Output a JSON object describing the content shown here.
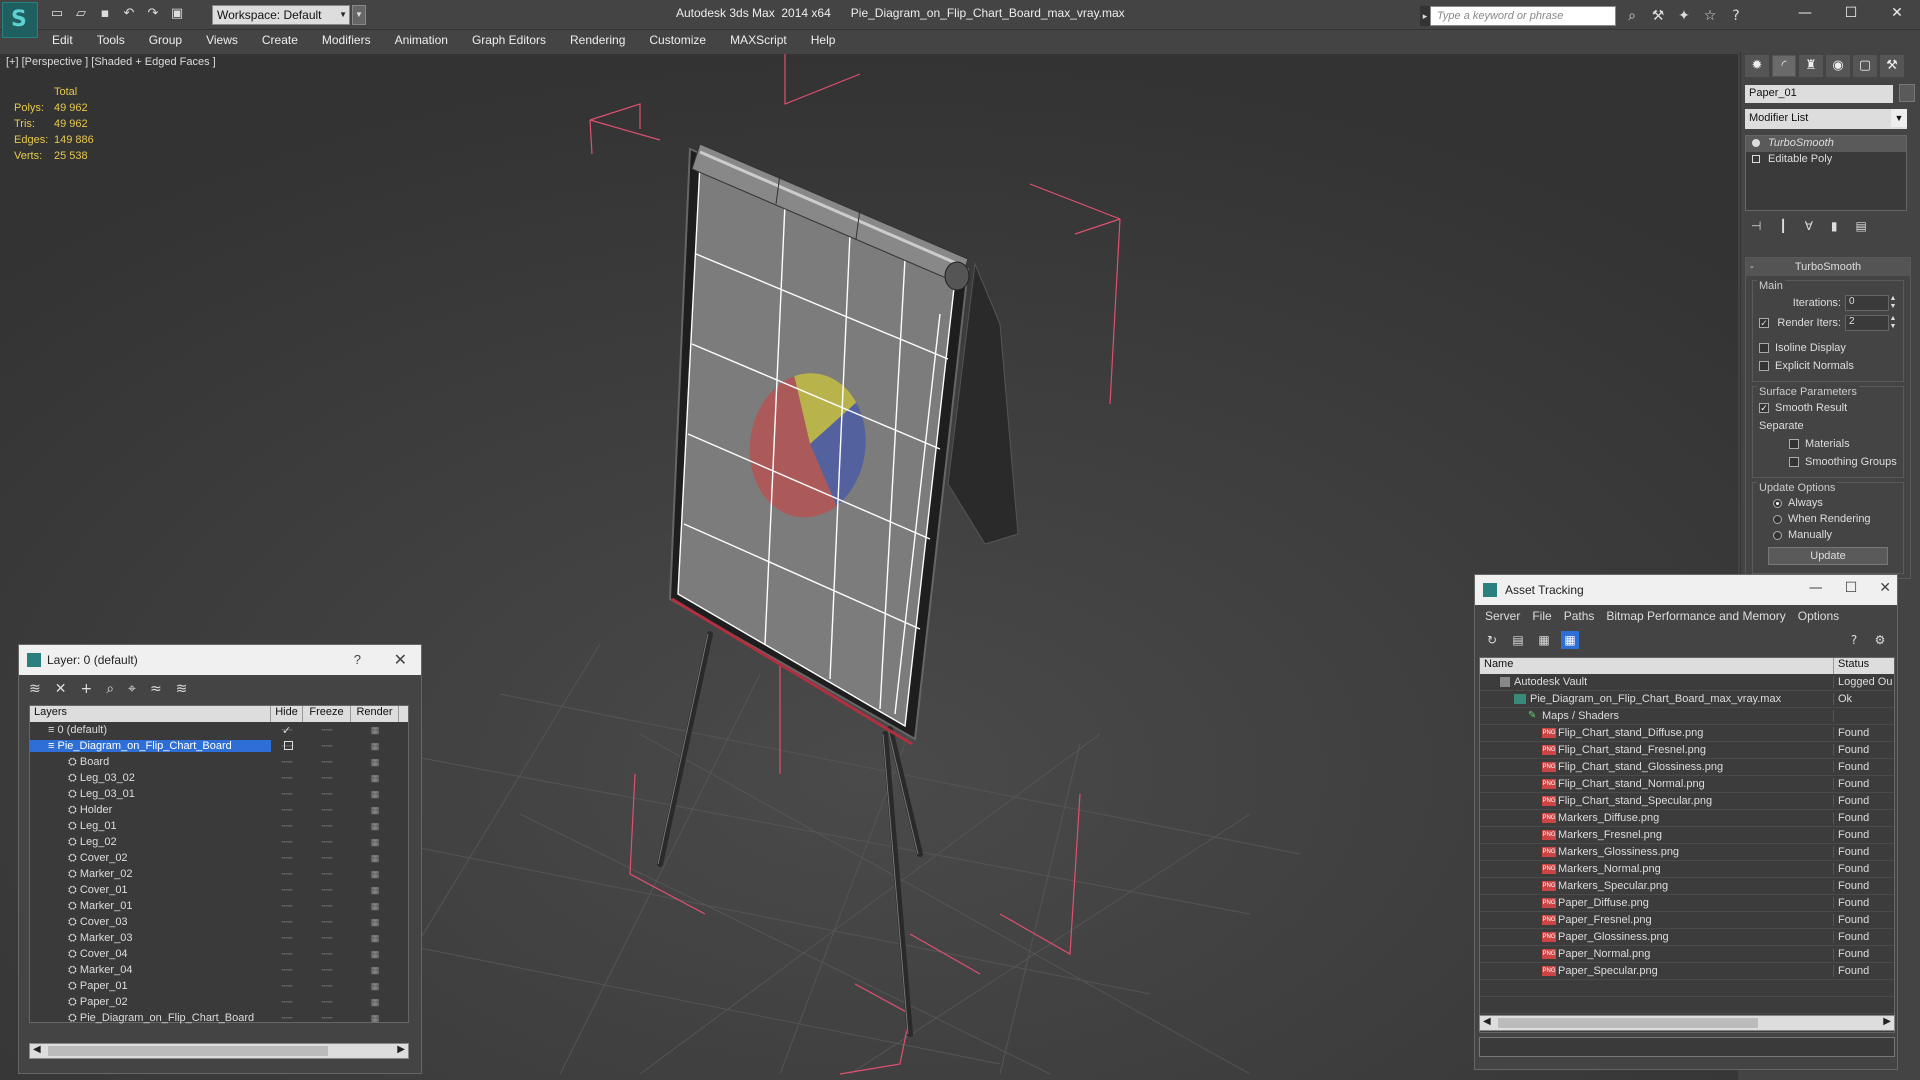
{
  "app": {
    "title": "Autodesk 3ds Max  2014 x64      Pie_Diagram_on_Flip_Chart_Board_max_vray.max",
    "workspace": "Workspace: Default",
    "search_placeholder": "Type a keyword or phrase"
  },
  "menu": [
    "Edit",
    "Tools",
    "Group",
    "Views",
    "Create",
    "Modifiers",
    "Animation",
    "Graph Editors",
    "Rendering",
    "Customize",
    "MAXScript",
    "Help"
  ],
  "viewport": {
    "label": "[+] [Perspective ] [Shaded + Edged Faces ]",
    "stats": {
      "header": "Total",
      "rows": [
        {
          "k": "Polys:",
          "v": "49 962"
        },
        {
          "k": "Tris:",
          "v": "49 962"
        },
        {
          "k": "Edges:",
          "v": "149 886"
        },
        {
          "k": "Verts:",
          "v": "25 538"
        }
      ]
    }
  },
  "command_panel": {
    "object_name": "Paper_01",
    "modifier_list": "Modifier List",
    "stack": [
      "TurboSmooth",
      "Editable Poly"
    ],
    "rollout_title": "TurboSmooth",
    "main": {
      "title": "Main",
      "iterations_label": "Iterations:",
      "iterations_value": "0",
      "render_iters_label": "Render Iters:",
      "render_iters_value": "2",
      "isoline": "Isoline Display",
      "explicit_normals": "Explicit Normals"
    },
    "surface": {
      "title": "Surface Parameters",
      "smooth_result": "Smooth Result",
      "separate": "Separate",
      "materials": "Materials",
      "smoothing_groups": "Smoothing Groups"
    },
    "update": {
      "title": "Update Options",
      "always": "Always",
      "when_rendering": "When Rendering",
      "manually": "Manually",
      "button": "Update"
    }
  },
  "layer_window": {
    "title": "Layer: 0 (default)",
    "help": "?",
    "columns": [
      "Layers",
      "Hide",
      "Freeze",
      "Render"
    ],
    "rows": [
      {
        "name": "0 (default)",
        "level": 0,
        "check": true
      },
      {
        "name": "Pie_Diagram_on_Flip_Chart_Board",
        "level": 0,
        "selected": true
      },
      {
        "name": "Board",
        "level": 1
      },
      {
        "name": "Leg_03_02",
        "level": 1
      },
      {
        "name": "Leg_03_01",
        "level": 1
      },
      {
        "name": "Holder",
        "level": 1
      },
      {
        "name": "Leg_01",
        "level": 1
      },
      {
        "name": "Leg_02",
        "level": 1
      },
      {
        "name": "Cover_02",
        "level": 1
      },
      {
        "name": "Marker_02",
        "level": 1
      },
      {
        "name": "Cover_01",
        "level": 1
      },
      {
        "name": "Marker_01",
        "level": 1
      },
      {
        "name": "Cover_03",
        "level": 1
      },
      {
        "name": "Marker_03",
        "level": 1
      },
      {
        "name": "Cover_04",
        "level": 1
      },
      {
        "name": "Marker_04",
        "level": 1
      },
      {
        "name": "Paper_01",
        "level": 1
      },
      {
        "name": "Paper_02",
        "level": 1
      },
      {
        "name": "Pie_Diagram_on_Flip_Chart_Board",
        "level": 1
      }
    ]
  },
  "asset_window": {
    "title": "Asset Tracking",
    "menu": [
      "Server",
      "File",
      "Paths",
      "Bitmap Performance and Memory",
      "Options"
    ],
    "columns": [
      "Name",
      "Status"
    ],
    "rows": [
      {
        "name": "Autodesk Vault",
        "status": "Logged Ou",
        "type": "vault",
        "level": 1
      },
      {
        "name": "Pie_Diagram_on_Flip_Chart_Board_max_vray.max",
        "status": "Ok",
        "type": "file",
        "level": 2
      },
      {
        "name": "Maps / Shaders",
        "status": "",
        "type": "maps",
        "level": 3
      },
      {
        "name": "Flip_Chart_stand_Diffuse.png",
        "status": "Found",
        "type": "png",
        "level": 4
      },
      {
        "name": "Flip_Chart_stand_Fresnel.png",
        "status": "Found",
        "type": "png",
        "level": 4
      },
      {
        "name": "Flip_Chart_stand_Glossiness.png",
        "status": "Found",
        "type": "png",
        "level": 4
      },
      {
        "name": "Flip_Chart_stand_Normal.png",
        "status": "Found",
        "type": "png",
        "level": 4
      },
      {
        "name": "Flip_Chart_stand_Specular.png",
        "status": "Found",
        "type": "png",
        "level": 4
      },
      {
        "name": "Markers_Diffuse.png",
        "status": "Found",
        "type": "png",
        "level": 4
      },
      {
        "name": "Markers_Fresnel.png",
        "status": "Found",
        "type": "png",
        "level": 4
      },
      {
        "name": "Markers_Glossiness.png",
        "status": "Found",
        "type": "png",
        "level": 4
      },
      {
        "name": "Markers_Normal.png",
        "status": "Found",
        "type": "png",
        "level": 4
      },
      {
        "name": "Markers_Specular.png",
        "status": "Found",
        "type": "png",
        "level": 4
      },
      {
        "name": "Paper_Diffuse.png",
        "status": "Found",
        "type": "png",
        "level": 4
      },
      {
        "name": "Paper_Fresnel.png",
        "status": "Found",
        "type": "png",
        "level": 4
      },
      {
        "name": "Paper_Glossiness.png",
        "status": "Found",
        "type": "png",
        "level": 4
      },
      {
        "name": "Paper_Normal.png",
        "status": "Found",
        "type": "png",
        "level": 4
      },
      {
        "name": "Paper_Specular.png",
        "status": "Found",
        "type": "png",
        "level": 4
      }
    ]
  },
  "colors": {
    "accent": "#2d6fd6",
    "stats": "#e6c84a",
    "bounding_box": "#e05070",
    "pie_yellow": "#d8d040",
    "pie_red": "#c85050",
    "pie_blue": "#4a5aa8"
  }
}
